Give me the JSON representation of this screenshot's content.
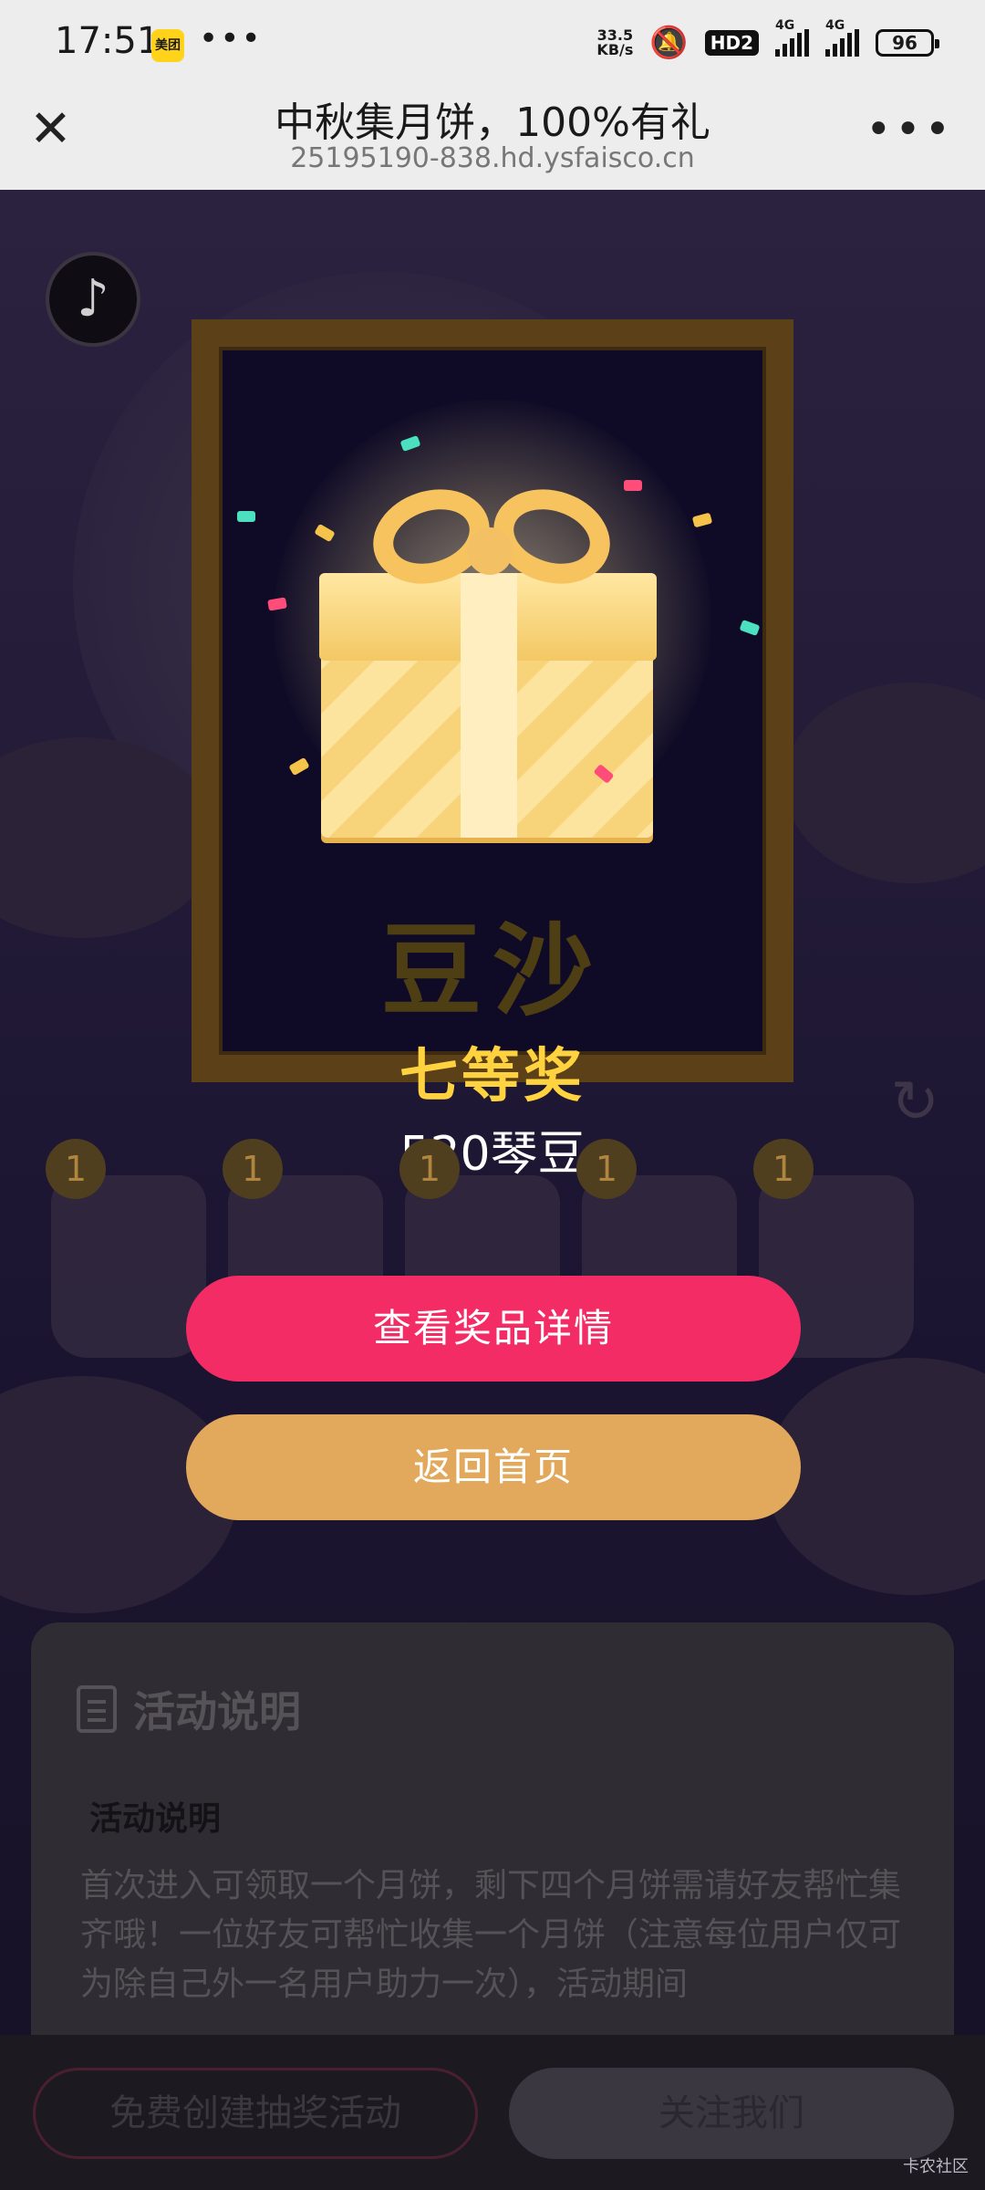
{
  "status_bar": {
    "time": "17:51",
    "app_badge": "美团",
    "more": "•••",
    "net_speed_value": "33.5",
    "net_speed_unit": "KB/s",
    "hd_badge": "HD2",
    "net_label_1": "4G",
    "net_label_2": "4G",
    "battery": "96"
  },
  "title_bar": {
    "title": "中秋集月饼，100%有礼",
    "url": "25195190-838.hd.ysfaisco.cn",
    "close_icon": "close-icon",
    "more_icon": "more-icon"
  },
  "result": {
    "faded_mooncake_name": "豆沙",
    "prize_level": "七等奖",
    "prize_amount": "520琴豆"
  },
  "jars": [
    {
      "count": "1"
    },
    {
      "count": "1"
    },
    {
      "count": "1"
    },
    {
      "count": "1"
    },
    {
      "count": "1"
    }
  ],
  "buttons": {
    "view_prize": "查看奖品详情",
    "back_home": "返回首页"
  },
  "info": {
    "heading": "活动说明",
    "subheading": "活动说明",
    "body": "首次进入可领取一个月饼，剩下四个月饼需请好友帮忙集齐哦！一位好友可帮忙收集一个月饼（注意每位用户仅可为除自己外一名用户助力一次），活动期间"
  },
  "bottom_bar": {
    "create": "免费创建抽奖活动",
    "follow": "关注我们"
  },
  "watermark": "卡农社区",
  "colors": {
    "primary": "#f42c66",
    "secondary": "#e2a95c",
    "prize_gold": "#ffd23f"
  }
}
